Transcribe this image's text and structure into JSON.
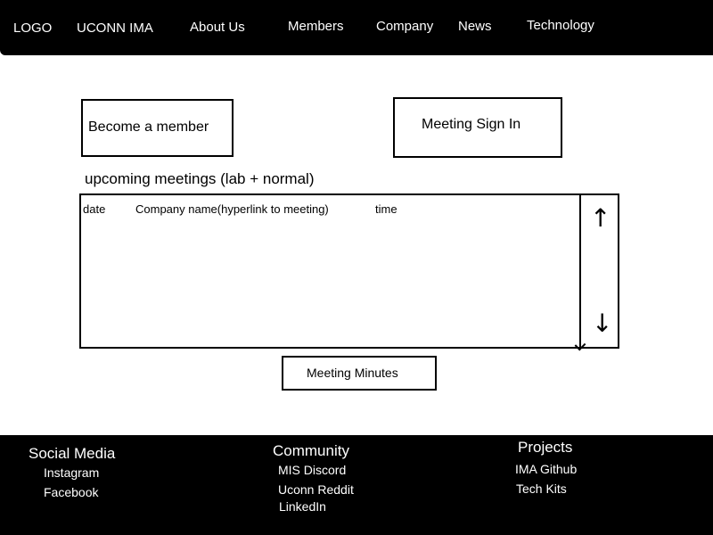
{
  "header": {
    "logo": "LOGO",
    "brand": "UCONN IMA",
    "nav": [
      "About Us",
      "Members",
      "Company",
      "News",
      "Technology"
    ]
  },
  "actions": {
    "become_member": "Become a member",
    "meeting_sign_in": "Meeting Sign In",
    "meeting_minutes": "Meeting Minutes"
  },
  "meetings": {
    "title": "upcoming meetings (lab + normal)",
    "columns": [
      "date",
      "Company name(hyperlink to meeting)",
      "time"
    ],
    "scroll_up": "↑",
    "scroll_down": "↓"
  },
  "footer": {
    "social": {
      "heading": "Social Media",
      "links": [
        "Instagram",
        "Facebook"
      ]
    },
    "community": {
      "heading": "Community",
      "links": [
        "MIS Discord",
        "Uconn Reddit",
        "LinkedIn"
      ]
    },
    "projects": {
      "heading": "Projects",
      "links": [
        "IMA Github",
        "Tech Kits"
      ]
    }
  }
}
